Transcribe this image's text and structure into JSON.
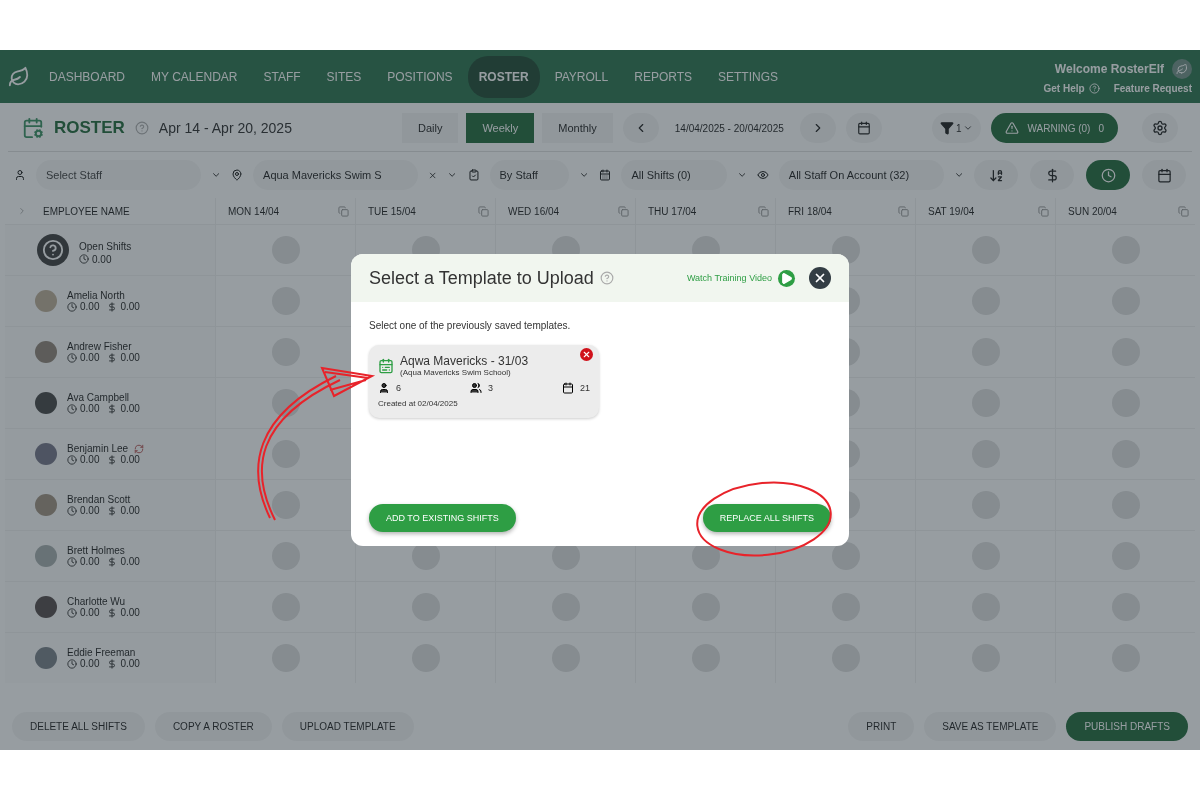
{
  "nav": {
    "items": [
      {
        "label": "DASHBOARD",
        "selected": false
      },
      {
        "label": "MY CALENDAR",
        "selected": false
      },
      {
        "label": "STAFF",
        "selected": false
      },
      {
        "label": "SITES",
        "selected": false
      },
      {
        "label": "POSITIONS",
        "selected": false
      },
      {
        "label": "ROSTER",
        "selected": true
      },
      {
        "label": "PAYROLL",
        "selected": false
      },
      {
        "label": "REPORTS",
        "selected": false
      },
      {
        "label": "SETTINGS",
        "selected": false
      }
    ],
    "welcome": "Welcome RosterElf",
    "help": "Get Help",
    "feature": "Feature Request"
  },
  "header": {
    "title": "ROSTER",
    "date_range": "Apr 14 - Apr 20, 2025",
    "views": [
      {
        "label": "Daily",
        "selected": false
      },
      {
        "label": "Weekly",
        "selected": true
      },
      {
        "label": "Monthly",
        "selected": false
      }
    ],
    "range": "14/04/2025 - 20/04/2025",
    "filter_count": "1",
    "warning": "WARNING (0)",
    "warning_count": "0"
  },
  "filters": {
    "staff_placeholder": "Select Staff",
    "site": "Aqua Mavericks Swim S",
    "group": "By Staff",
    "shifts": "All Shifts (0)",
    "account": "All Staff On Account (32)",
    "sort_buttons": [
      {
        "kind": "alpha",
        "selected": false
      },
      {
        "kind": "cost",
        "selected": false
      },
      {
        "kind": "time",
        "selected": true
      },
      {
        "kind": "calendar",
        "selected": false
      }
    ]
  },
  "table": {
    "name_column": "EMPLOYEE NAME",
    "days": [
      "MON 14/04",
      "TUE 15/04",
      "WED 16/04",
      "THU 17/04",
      "FRI 18/04",
      "SAT 19/04",
      "SUN 20/04"
    ],
    "open_shifts": {
      "name": "Open Shifts",
      "hours": "0.00"
    },
    "rows": [
      {
        "name": "Amelia North",
        "hours": "0.00",
        "cost": "0.00",
        "badge": false
      },
      {
        "name": "Andrew Fisher",
        "hours": "0.00",
        "cost": "0.00",
        "badge": false
      },
      {
        "name": "Ava Campbell",
        "hours": "0.00",
        "cost": "0.00",
        "badge": false
      },
      {
        "name": "Benjamin Lee",
        "hours": "0.00",
        "cost": "0.00",
        "badge": true
      },
      {
        "name": "Brendan Scott",
        "hours": "0.00",
        "cost": "0.00",
        "badge": false
      },
      {
        "name": "Brett Holmes",
        "hours": "0.00",
        "cost": "0.00",
        "badge": false
      },
      {
        "name": "Charlotte Wu",
        "hours": "0.00",
        "cost": "0.00",
        "badge": false
      },
      {
        "name": "Eddie Freeman",
        "hours": "0.00",
        "cost": "0.00",
        "badge": false
      }
    ]
  },
  "footer": {
    "left": [
      "DELETE ALL SHIFTS",
      "COPY A ROSTER",
      "UPLOAD TEMPLATE"
    ],
    "right": [
      "PRINT",
      "SAVE AS TEMPLATE"
    ],
    "primary": "PUBLISH DRAFTS"
  },
  "modal": {
    "title": "Select a Template to Upload",
    "video_link": "Watch Training Video",
    "instruction": "Select one of the previously saved templates.",
    "templates": [
      {
        "name": "Aqwa Mavericks - 31/03",
        "site": "(Aqua Mavericks Swim School)",
        "staff": "6",
        "groups": "3",
        "shifts": "21",
        "created": "Created at 02/04/2025"
      }
    ],
    "buttons": [
      "ADD TO EXISTING SHIFTS",
      "REPLACE ALL SHIFTS"
    ]
  }
}
